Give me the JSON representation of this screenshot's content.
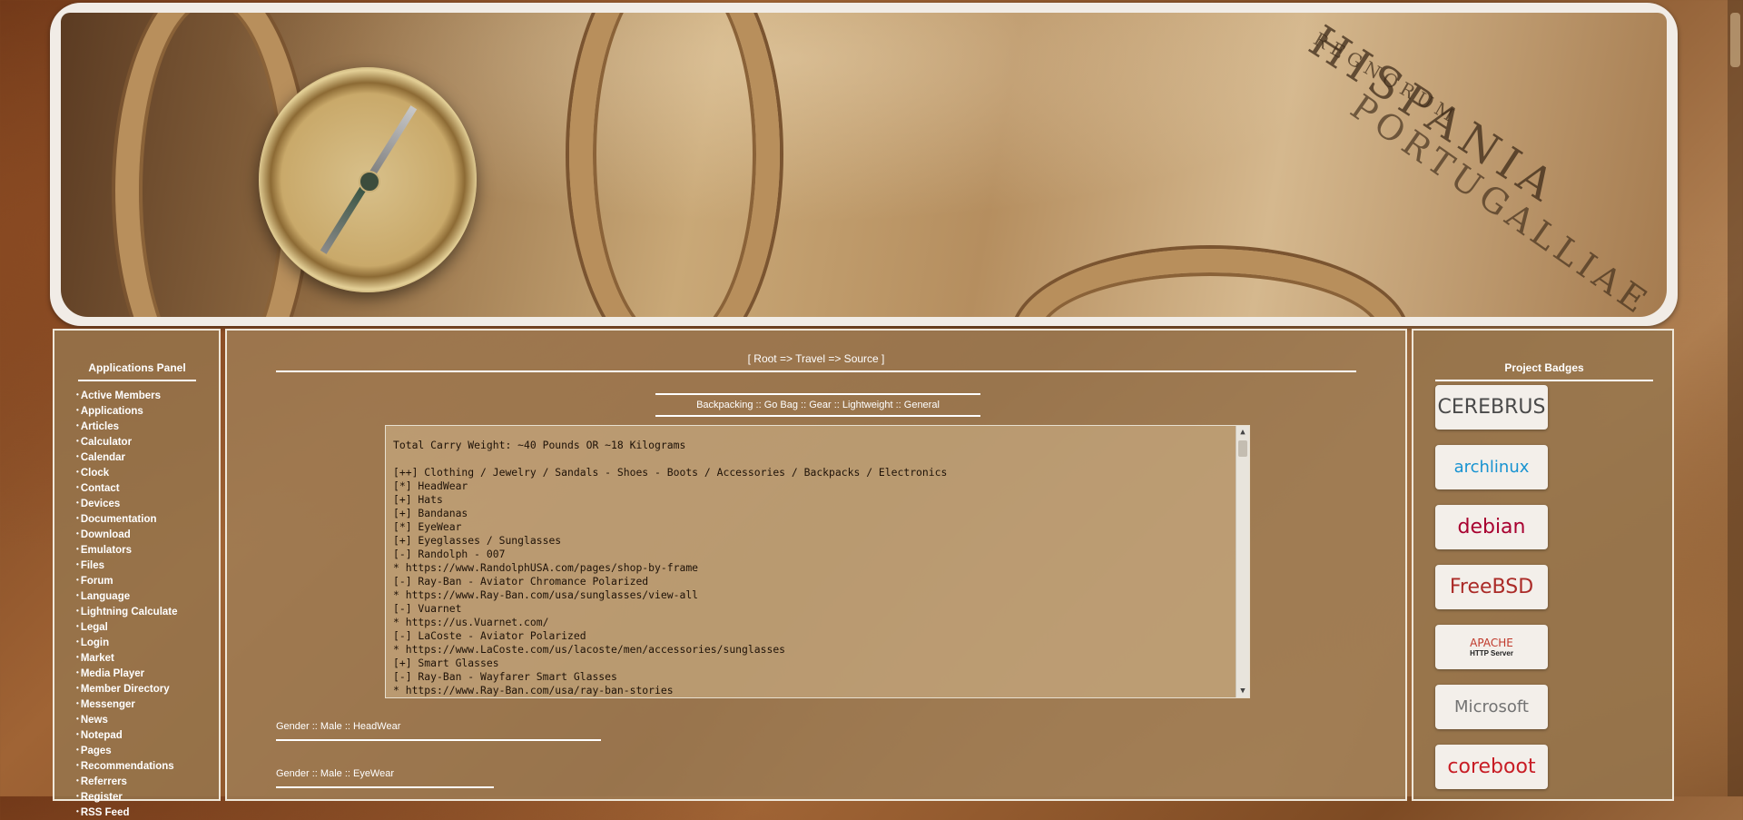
{
  "applications_panel": {
    "title": "Applications Panel",
    "items": [
      "Active Members",
      "Applications",
      "Articles",
      "Calculator",
      "Calendar",
      "Clock",
      "Contact",
      "Devices",
      "Documentation",
      "Download",
      "Emulators",
      "Files",
      "Forum",
      "Language",
      "Lightning Calculate",
      "Legal",
      "Login",
      "Market",
      "Media Player",
      "Member Directory",
      "Messenger",
      "News",
      "Notepad",
      "Pages",
      "Recommendations",
      "Referrers",
      "Register",
      "RSS Feed"
    ]
  },
  "breadcrumb": {
    "text": "[ Root => Travel => Source ]"
  },
  "categories": {
    "text": "Backpacking :: Go Bag :: Gear :: Lightweight :: General"
  },
  "content_box": {
    "lines": [
      "Total Carry Weight: ~40 Pounds OR ~18 Kilograms",
      "",
      "[++] Clothing / Jewelry / Sandals - Shoes - Boots / Accessories / Backpacks / Electronics",
      "[*] HeadWear",
      "[+] Hats",
      "[+] Bandanas",
      "[*] EyeWear",
      "[+] Eyeglasses / Sunglasses",
      "[-] Randolph - 007",
      "* https://www.RandolphUSA.com/pages/shop-by-frame",
      "[-] Ray-Ban - Aviator Chromance Polarized",
      "* https://www.Ray-Ban.com/usa/sunglasses/view-all",
      "[-] Vuarnet",
      "* https://us.Vuarnet.com/",
      "[-] LaCoste - Aviator Polarized",
      "* https://www.LaCoste.com/us/lacoste/men/accessories/sunglasses",
      "[+] Smart Glasses",
      "[-] Ray-Ban - Wayfarer Smart Glasses",
      "* https://www.Ray-Ban.com/usa/ray-ban-stories"
    ]
  },
  "sections": {
    "headwear": "Gender :: Male :: HeadWear",
    "eyewear": "Gender :: Male :: EyeWear"
  },
  "banner": {
    "map_title": "HISPANIA",
    "map_sub": "REGNORUM",
    "map_sub2": "PORTUGALLIAE"
  },
  "project_badges": {
    "title": "Project Badges",
    "badges": [
      {
        "name": "CEREBRUS",
        "color": "#4a4a4a"
      },
      {
        "name": "archlinux",
        "color": "#1793d1"
      },
      {
        "name": "debian",
        "color": "#a80030"
      },
      {
        "name": "FreeBSD",
        "color": "#ab2b28"
      },
      {
        "name": "APACHE",
        "sub": "HTTP Server",
        "color": "#c0392b"
      },
      {
        "name": "Microsoft",
        "color": "#737373"
      },
      {
        "name": "coreboot",
        "color": "#c81d25"
      }
    ]
  }
}
